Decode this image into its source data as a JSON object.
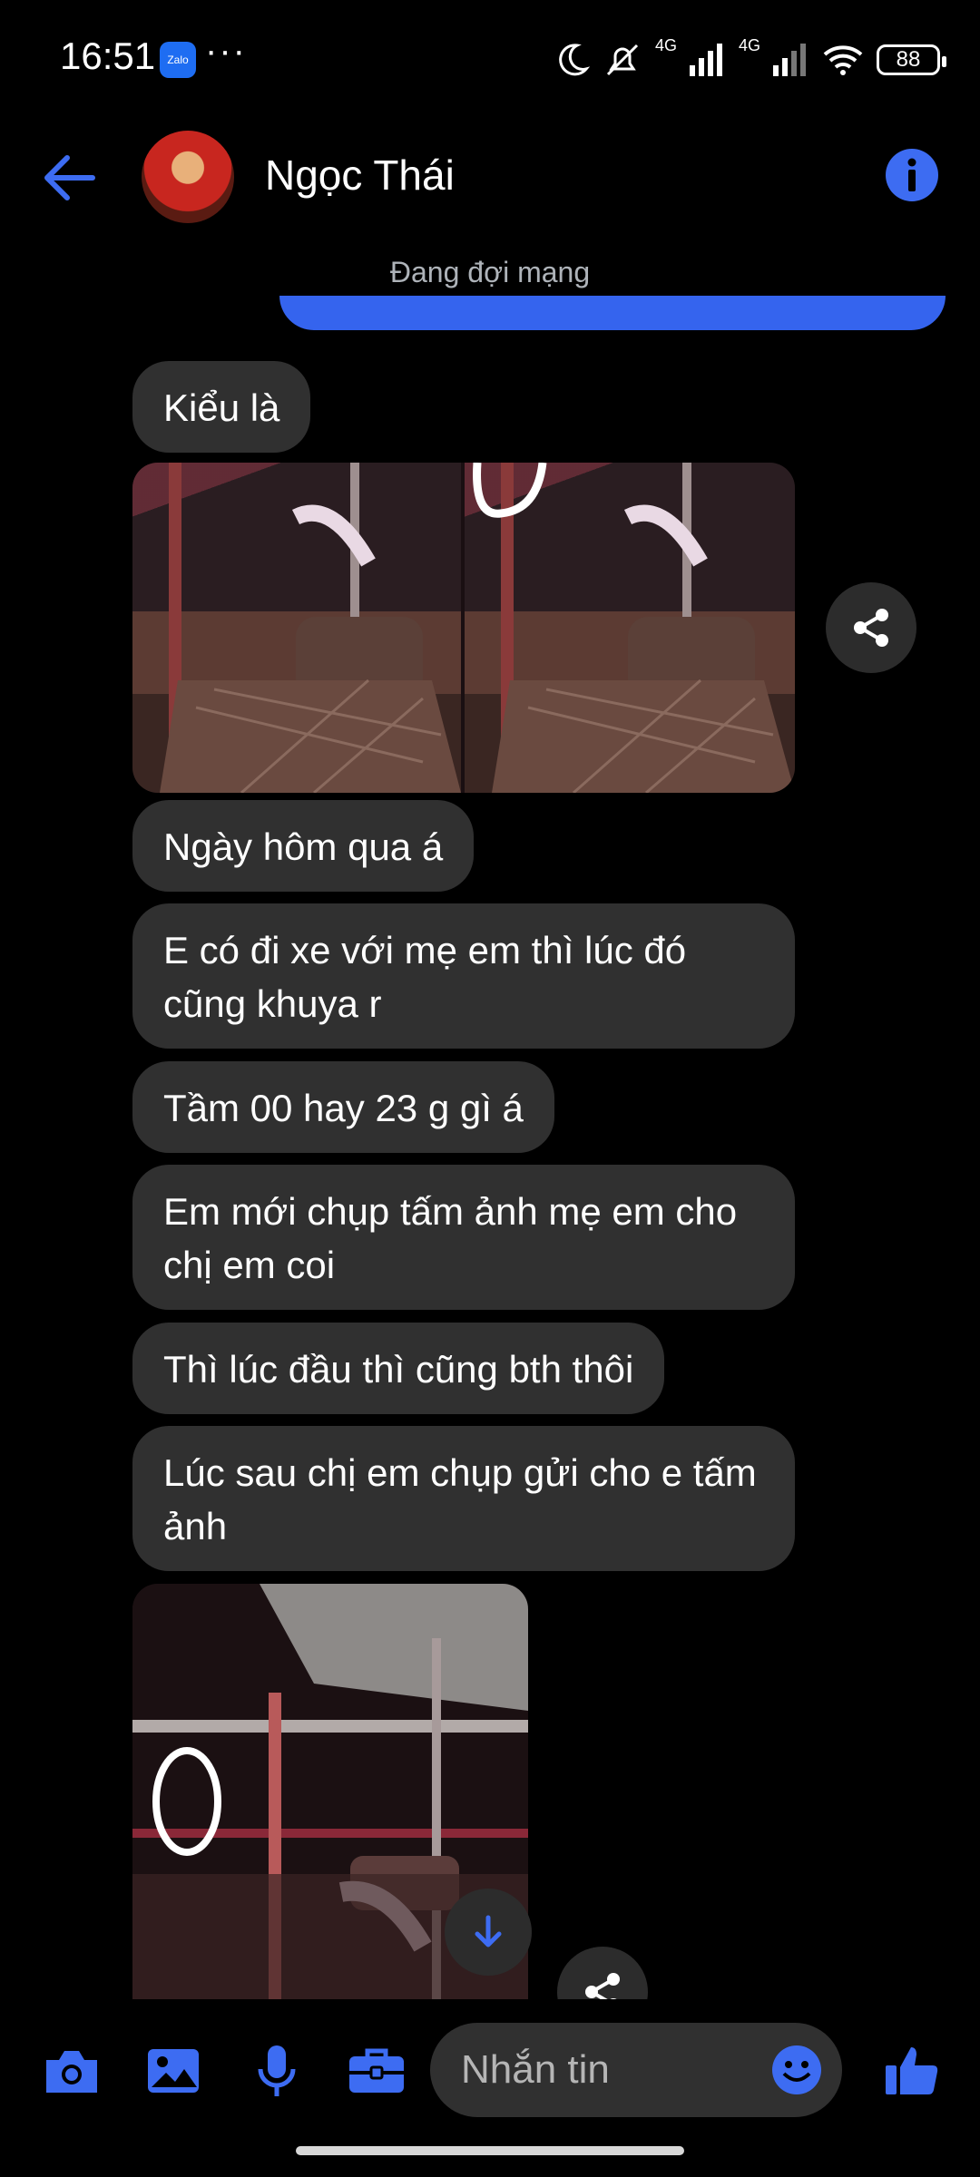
{
  "status_bar": {
    "time": "16:51",
    "zalo_label": "Zalo",
    "overflow": "···",
    "network_1": "4G",
    "network_2": "4G",
    "battery": "88"
  },
  "header": {
    "contact_name": "Ngọc Thái"
  },
  "connection_status": "Đang đợi mạng",
  "messages": [
    {
      "type": "text",
      "text": "Kiểu là"
    },
    {
      "type": "image"
    },
    {
      "type": "text",
      "text": "Ngày hôm qua á"
    },
    {
      "type": "text",
      "text": "E có đi xe với mẹ em thì lúc đó cũng khuya r"
    },
    {
      "type": "text",
      "text": "Tầm 00 hay 23 g gì á"
    },
    {
      "type": "text",
      "text": "Em mới chụp tấm ảnh mẹ em cho chị em coi"
    },
    {
      "type": "text",
      "text": "Thì lúc đầu thì cũng bth thôi"
    },
    {
      "type": "text",
      "text": "Lúc sau chị em chụp gửi cho e tấm ảnh"
    },
    {
      "type": "image"
    }
  ],
  "composer": {
    "placeholder": "Nhắn tin"
  },
  "colors": {
    "accent": "#3d6cf2",
    "bubble": "#303030",
    "background": "#000000"
  },
  "icons": [
    "back-arrow-icon",
    "info-icon",
    "share-icon",
    "arrow-down-icon",
    "camera-icon",
    "gallery-icon",
    "microphone-icon",
    "briefcase-icon",
    "emoji-icon",
    "thumbs-up-icon"
  ]
}
